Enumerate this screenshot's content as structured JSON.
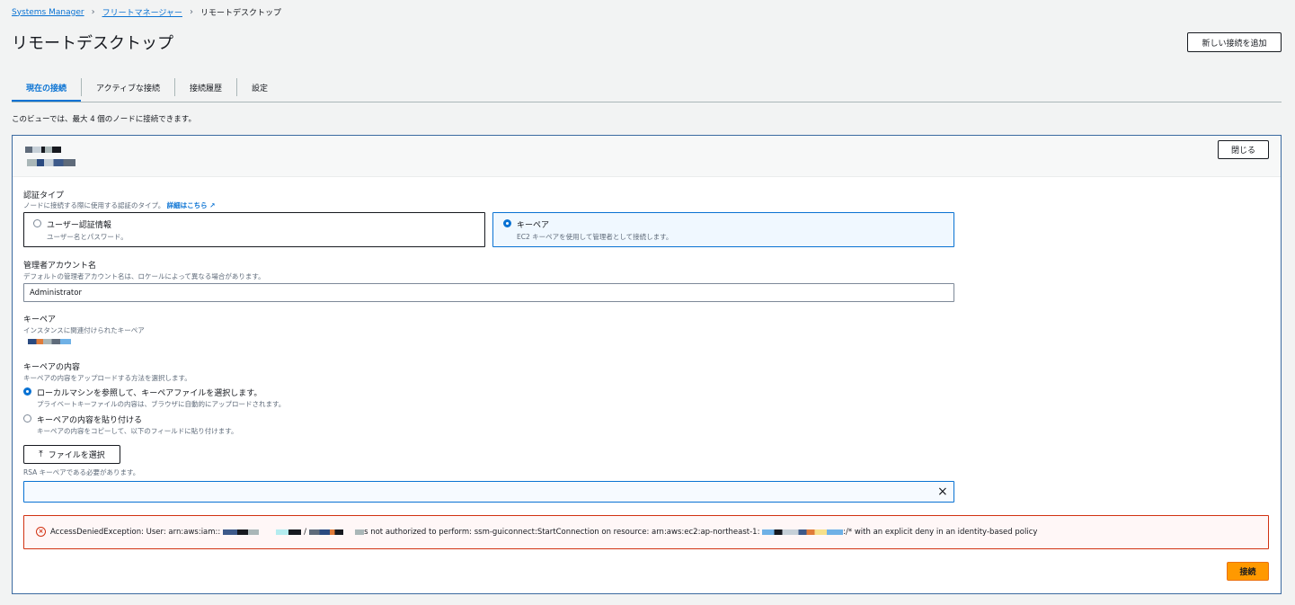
{
  "breadcrumb": {
    "root": "Systems Manager",
    "parent": "フリートマネージャー",
    "current": "リモートデスクトップ"
  },
  "page_title": "リモートデスクトップ",
  "add_connection_label": "新しい接続を追加",
  "tabs": [
    "現在の接続",
    "アクティブな接続",
    "接続履歴",
    "設定"
  ],
  "info_text": "このビューでは、最大 4 個のノードに接続できます。",
  "close_label": "閉じる",
  "auth": {
    "label": "認証タイプ",
    "desc": "ノードに接続する際に使用する認証のタイプ。",
    "learn_more": "詳細はこちら",
    "options": [
      {
        "title": "ユーザー認証情報",
        "desc": "ユーザー名とパスワード。",
        "selected": false
      },
      {
        "title": "キーペア",
        "desc": "EC2 キーペアを使用して管理者として接続します。",
        "selected": true
      }
    ]
  },
  "admin": {
    "label": "管理者アカウント名",
    "desc": "デフォルトの管理者アカウント名は、ロケールによって異なる場合があります。",
    "value": "Administrator"
  },
  "keypair": {
    "label": "キーペア",
    "desc": "インスタンスに関連付けられたキーペア"
  },
  "key_content": {
    "label": "キーペアの内容",
    "desc": "キーペアの内容をアップロードする方法を選択します。",
    "options": [
      {
        "title": "ローカルマシンを参照して、キーペアファイルを選択します。",
        "desc": "プライベートキーファイルの内容は、ブラウザに自動的にアップロードされます。",
        "selected": true
      },
      {
        "title": "キーペアの内容を貼り付ける",
        "desc": "キーペアの内容をコピーして、以下のフィールドに貼り付けます。",
        "selected": false
      }
    ],
    "choose_file_label": "ファイルを選択",
    "hint": "RSA キーペアである必要があります。",
    "clear_icon": "×"
  },
  "error": {
    "part1": "AccessDeniedException: User: arn:aws:iam::",
    "part2": "/",
    "part3": "s not authorized to perform: ssm-guiconnect:StartConnection on resource: arn:aws:ec2:ap-northeast-1:",
    "part4": ":/* with an explicit deny in an identity-based policy"
  },
  "connect_label": "接続",
  "colors": {
    "accent": "#0972d3",
    "primary_button": "#ff9900",
    "error": "#d13212"
  }
}
